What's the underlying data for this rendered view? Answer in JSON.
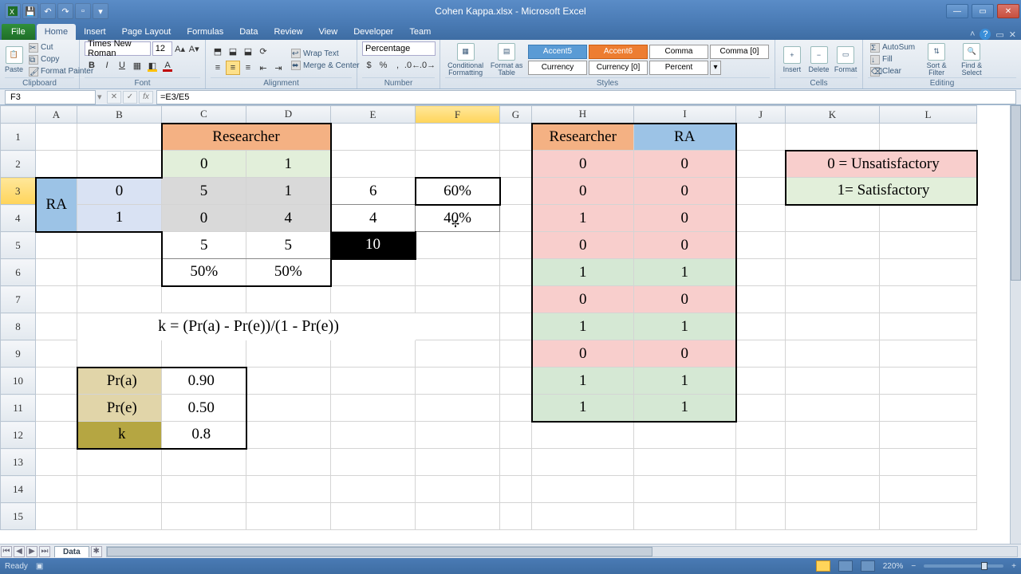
{
  "window": {
    "title": "Cohen Kappa.xlsx - Microsoft Excel"
  },
  "tabs": {
    "file": "File",
    "items": [
      "Home",
      "Insert",
      "Page Layout",
      "Formulas",
      "Data",
      "Review",
      "View",
      "Developer",
      "Team"
    ],
    "active": "Home"
  },
  "ribbon": {
    "clipboard": {
      "label": "Clipboard",
      "paste": "Paste",
      "cut": "Cut",
      "copy": "Copy",
      "fmtpainter": "Format Painter"
    },
    "font": {
      "label": "Font",
      "name": "Times New Roman",
      "size": "12"
    },
    "alignment": {
      "label": "Alignment",
      "wrap": "Wrap Text",
      "merge": "Merge & Center"
    },
    "number": {
      "label": "Number",
      "format": "Percentage"
    },
    "styles": {
      "label": "Styles",
      "cond": "Conditional Formatting",
      "astable": "Format as Table",
      "accent5": "Accent5",
      "accent6": "Accent6",
      "comma": "Comma",
      "comma0": "Comma [0]",
      "currency": "Currency",
      "currency0": "Currency [0]",
      "percent": "Percent"
    },
    "cells": {
      "label": "Cells",
      "insert": "Insert",
      "delete": "Delete",
      "format": "Format"
    },
    "editing": {
      "label": "Editing",
      "autosum": "AutoSum",
      "fill": "Fill",
      "clear": "Clear",
      "sort": "Sort & Filter",
      "find": "Find & Select"
    }
  },
  "formula_bar": {
    "name_box": "F3",
    "formula": "=E3/E5"
  },
  "columns": [
    "A",
    "B",
    "C",
    "D",
    "E",
    "F",
    "G",
    "H",
    "I",
    "J",
    "K",
    "L"
  ],
  "rows": [
    "1",
    "2",
    "3",
    "4",
    "5",
    "6",
    "7",
    "8",
    "9",
    "10",
    "11",
    "12",
    "13",
    "14",
    "15"
  ],
  "selected_col": "F",
  "selected_row": "3",
  "crosstab": {
    "researcher": "Researcher",
    "ra": "RA",
    "h0": "0",
    "h1": "1",
    "r0": "0",
    "r1": "1",
    "c00": "5",
    "c01": "1",
    "c10": "0",
    "c11": "4",
    "rowtot0": "6",
    "rowtot1": "4",
    "rowpct0": "60%",
    "rowpct1": "40%",
    "coltot0": "5",
    "coltot1": "5",
    "grand": "10",
    "colpct0": "50%",
    "colpct1": "50%"
  },
  "formula_text": "k = (Pr(a) - Pr(e))/(1 - Pr(e))",
  "stats": {
    "pra_label": "Pr(a)",
    "pra": "0.90",
    "pre_label": "Pr(e)",
    "pre": "0.50",
    "k_label": "k",
    "k": "0.8"
  },
  "pairs": {
    "header_researcher": "Researcher",
    "header_ra": "RA",
    "rows": [
      {
        "r": "0",
        "a": "0"
      },
      {
        "r": "0",
        "a": "0"
      },
      {
        "r": "1",
        "a": "0"
      },
      {
        "r": "0",
        "a": "0"
      },
      {
        "r": "1",
        "a": "1"
      },
      {
        "r": "0",
        "a": "0"
      },
      {
        "r": "1",
        "a": "1"
      },
      {
        "r": "0",
        "a": "0"
      },
      {
        "r": "1",
        "a": "1"
      },
      {
        "r": "1",
        "a": "1"
      }
    ]
  },
  "legend": {
    "l0": "0 = Unsatisfactory",
    "l1": "1= Satisfactory"
  },
  "sheet_tab": "Data",
  "status": {
    "ready": "Ready",
    "zoom": "220%"
  }
}
